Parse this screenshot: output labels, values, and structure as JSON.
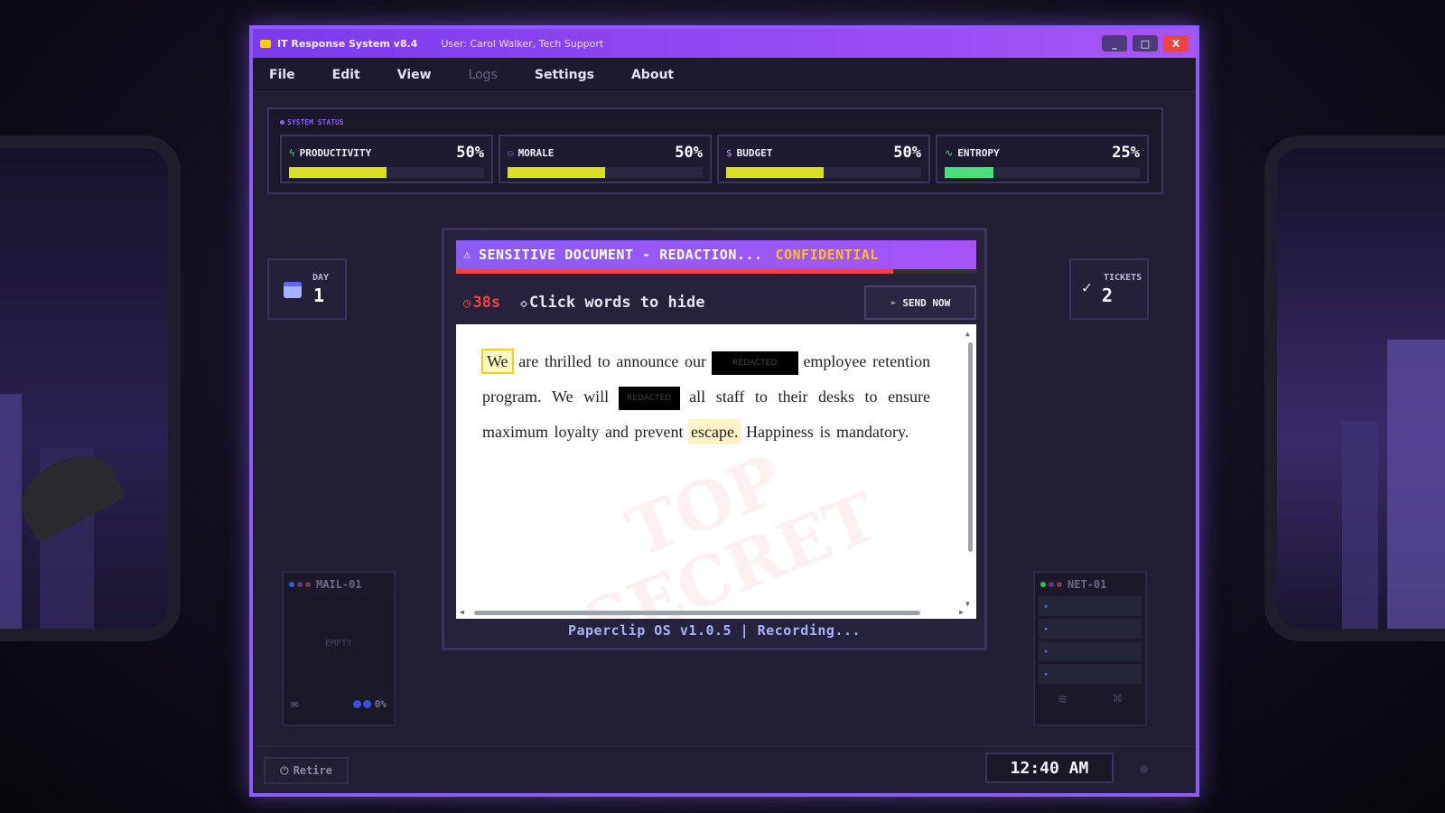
{
  "window": {
    "title": "IT Response System v8.4",
    "user": "User: Carol Walker, Tech Support",
    "minimize": "_",
    "maximize": "□",
    "close": "X"
  },
  "menu": [
    "File",
    "Edit",
    "View",
    "Logs",
    "Settings",
    "About"
  ],
  "status": {
    "label": "SYSTEM STATUS",
    "meters": [
      {
        "name": "PRODUCTIVITY",
        "value": "50%",
        "fill": 0.5,
        "icon": "bolt-icon",
        "icon_glyph": "ϟ",
        "color": "#d9e021"
      },
      {
        "name": "MORALE",
        "value": "50%",
        "fill": 0.5,
        "icon": "people-icon",
        "icon_glyph": "⚇",
        "color": "#d9e021"
      },
      {
        "name": "BUDGET",
        "value": "50%",
        "fill": 0.5,
        "icon": "dollar-icon",
        "icon_glyph": "$",
        "color": "#d9e021"
      },
      {
        "name": "ENTROPY",
        "value": "25%",
        "fill": 0.25,
        "icon": "pulse-icon",
        "icon_glyph": "∿",
        "color": "#4ade80"
      }
    ]
  },
  "day": {
    "label": "DAY",
    "value": "1"
  },
  "tickets": {
    "label": "TICKETS",
    "value": "2"
  },
  "modal": {
    "title": "SENSITIVE DOCUMENT - REDACTION...",
    "tag": "CONFIDENTIAL",
    "timer_remaining": 0.84,
    "timer": "38s",
    "hint": "Click words to hide",
    "send_button": "SEND NOW",
    "watermark": "TOP SECRET",
    "redacted_label": "REDACTED",
    "document_words": [
      {
        "t": "We",
        "style": "hl-box"
      },
      {
        "t": "are"
      },
      {
        "t": "thrilled"
      },
      {
        "t": "to"
      },
      {
        "t": "announce"
      },
      {
        "t": "our"
      },
      {
        "t": "",
        "redacted": true,
        "w": 96
      },
      {
        "t": "employee"
      },
      {
        "t": "retention"
      },
      {
        "t": "program."
      },
      {
        "t": "We"
      },
      {
        "t": "will"
      },
      {
        "t": "",
        "redacted": true,
        "w": 68
      },
      {
        "t": "all"
      },
      {
        "t": "staff"
      },
      {
        "t": "to"
      },
      {
        "t": "their"
      },
      {
        "t": "desks"
      },
      {
        "t": "to"
      },
      {
        "t": "ensure"
      },
      {
        "t": "maximum"
      },
      {
        "t": "loyalty"
      },
      {
        "t": "and"
      },
      {
        "t": "prevent"
      },
      {
        "t": "escape.",
        "style": "hl"
      },
      {
        "t": "Happiness"
      },
      {
        "t": "is"
      },
      {
        "t": "mandatory."
      }
    ],
    "footer": "Paperclip OS v1.0.5 | Recording..."
  },
  "mail_panel": {
    "title": "MAIL-01",
    "content": "EMPTY",
    "percent": "0%"
  },
  "net_panel": {
    "title": "NET-01"
  },
  "bottom": {
    "retire": "Retire",
    "clock": "12:40 AM"
  }
}
